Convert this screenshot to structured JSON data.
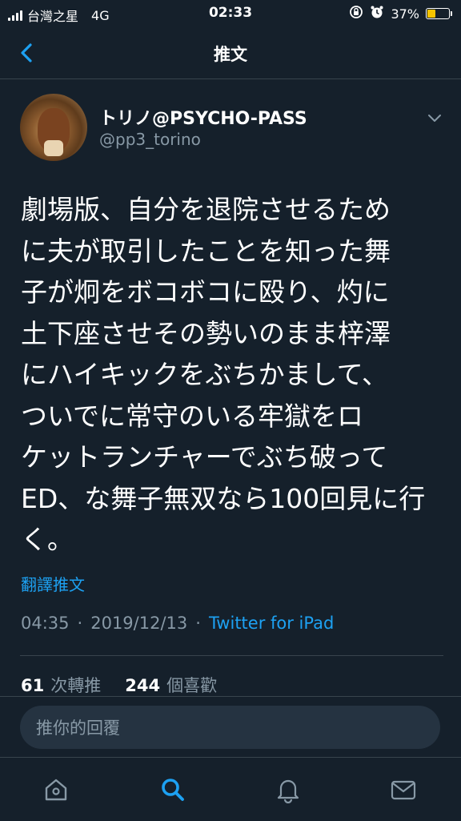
{
  "status_bar": {
    "carrier": "台灣之星",
    "network": "4G",
    "time": "02:33",
    "battery_percent": "37%",
    "battery_level": 0.37,
    "battery_color": "#f5c400"
  },
  "nav": {
    "title": "推文",
    "back_icon": "chevron-left-icon"
  },
  "tweet": {
    "display_name": "トリノ@PSYCHO-PASS",
    "username": "@pp3_torino",
    "text": "劇場版、自分を退院させるため\nに夫が取引したことを知った舞\n子が炯をボコボコに殴り、灼に\n土下座させその勢いのまま梓澤\nにハイキックをぶちかまして、\nついでに常守のいる牢獄をロ\nケットランチャーでぶち破って\nED、な舞子無双なら100回見に行\nく。",
    "translate_label": "翻譯推文",
    "time": "04:35",
    "date": "2019/12/13",
    "source": "Twitter for iPad",
    "retweets_count": "61",
    "retweets_label": "次轉推",
    "likes_count": "244",
    "likes_label": "個喜歡"
  },
  "reply": {
    "placeholder": "推你的回覆"
  },
  "tab_bar": {
    "items": [
      "home-icon",
      "search-icon",
      "notifications-icon",
      "messages-icon"
    ],
    "active": "search-icon",
    "active_color": "#1da1f2"
  },
  "colors": {
    "background": "#15202b",
    "accent": "#1da1f2",
    "secondary_text": "#8899a6",
    "divider": "#38444d"
  }
}
